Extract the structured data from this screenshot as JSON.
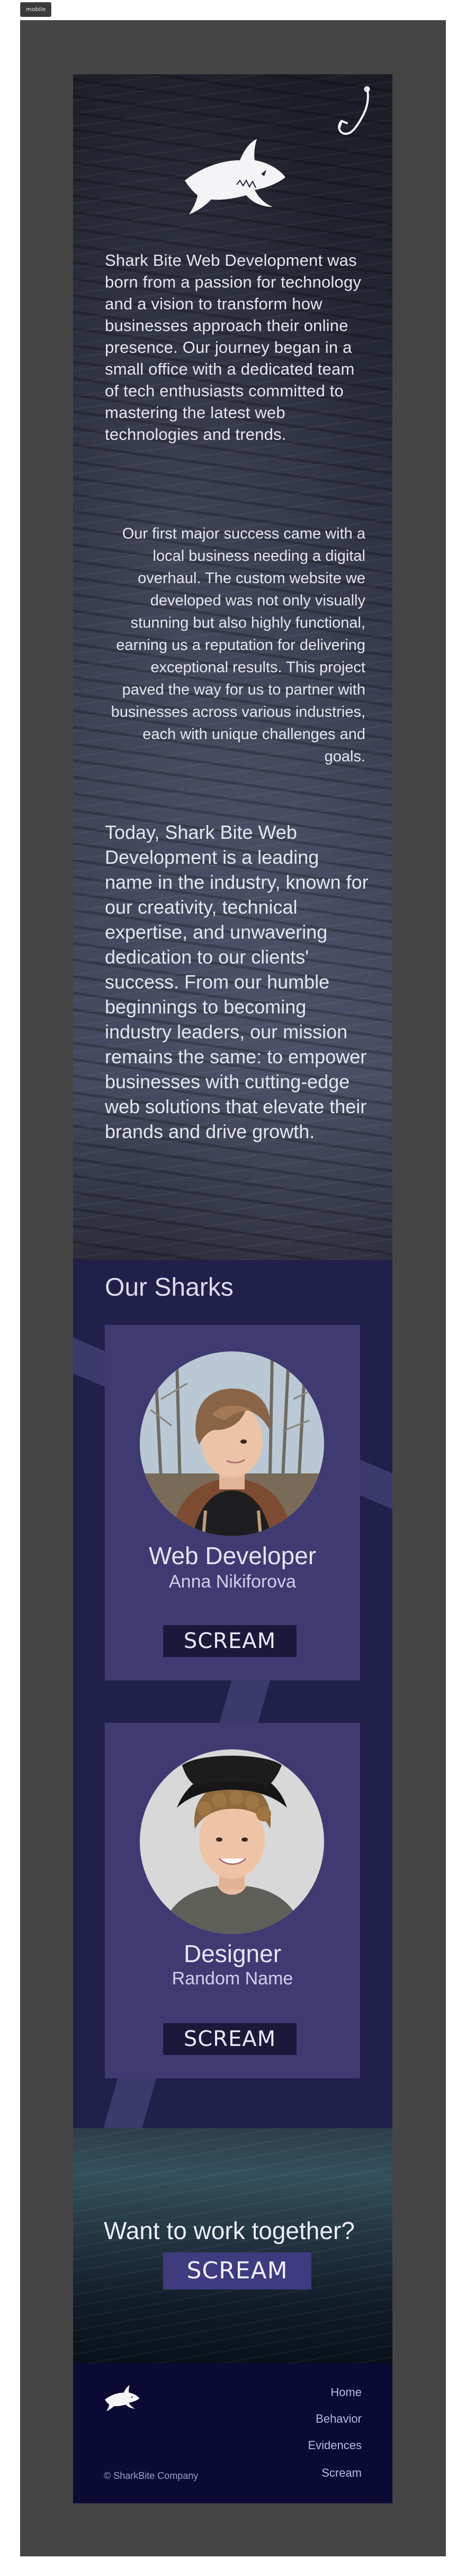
{
  "device_tag": "mobile",
  "hero": {
    "paragraph_1": "Shark Bite Web Development was born from a passion for technology and a vision to transform how businesses approach their online presence. Our journey began in a small office with a dedicated team of tech enthusiasts committed to mastering the latest web technologies and trends.",
    "paragraph_2": "Our first major success came with a local business needing a digital overhaul. The custom website we developed was not only visually stunning but also highly functional, earning us a reputation for delivering exceptional results. This project paved the way for us to partner with businesses across various industries, each with unique challenges and goals.",
    "paragraph_3": "Today, Shark Bite Web Development is a leading name in the industry, known for our creativity, technical expertise, and unwavering dedication to our clients' success. From our humble beginnings to becoming industry leaders, our mission remains the same: to empower businesses with cutting-edge web solutions that elevate their brands and drive growth."
  },
  "sharks": {
    "title": "Our Sharks",
    "members": [
      {
        "role": "Web Developer",
        "name": "Anna Nikiforova",
        "button": "SCREAM"
      },
      {
        "role": "Designer",
        "name": "Random Name",
        "button": "SCREAM"
      }
    ]
  },
  "cta": {
    "title": "Want to work together?",
    "button": "SCREAM"
  },
  "footer": {
    "copyright": "© SharkBite Company",
    "nav": [
      "Home",
      "Behavior",
      "Evidences",
      "Scream"
    ]
  },
  "colors": {
    "page_frame": "#454545",
    "sharks_bg": "#20204a",
    "card_bg": "#3f3b72",
    "button_dark": "#1a193a",
    "cta_button": "#3f3b7e",
    "footer_bg": "#0b0a34"
  }
}
